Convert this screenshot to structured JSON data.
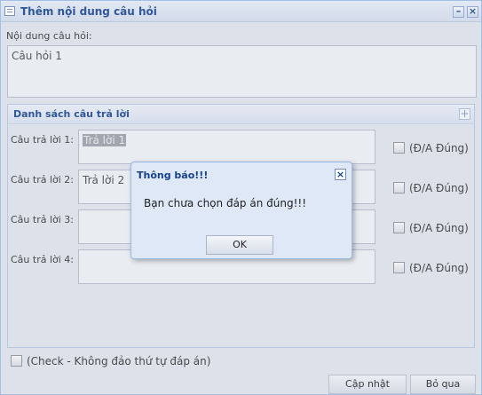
{
  "window": {
    "title": "Thêm nội dung câu hỏi"
  },
  "question": {
    "label": "Nội dung câu hỏi:",
    "value": "Câu hỏi 1"
  },
  "answers_section": {
    "legend": "Danh sách câu trả lời",
    "items": [
      {
        "label": "Câu trả lời 1:",
        "value": "Trả lời 1",
        "correct_label": "(Đ/A Đúng)"
      },
      {
        "label": "Câu trả lời 2:",
        "value": "Trả lời 2",
        "correct_label": "(Đ/A Đúng)"
      },
      {
        "label": "Câu trả lời 3:",
        "value": "",
        "correct_label": "(Đ/A Đúng)"
      },
      {
        "label": "Câu trả lời 4:",
        "value": "",
        "correct_label": "(Đ/A Đúng)"
      }
    ]
  },
  "no_shuffle": {
    "label": "(Check - Không đảo thứ tự đáp án)"
  },
  "footer": {
    "update_label": "Cập nhật",
    "skip_label": "Bỏ qua"
  },
  "dialog": {
    "title": "Thông báo!!!",
    "message": "Bạn chưa chọn đáp án đúng!!!",
    "ok_label": "OK"
  }
}
